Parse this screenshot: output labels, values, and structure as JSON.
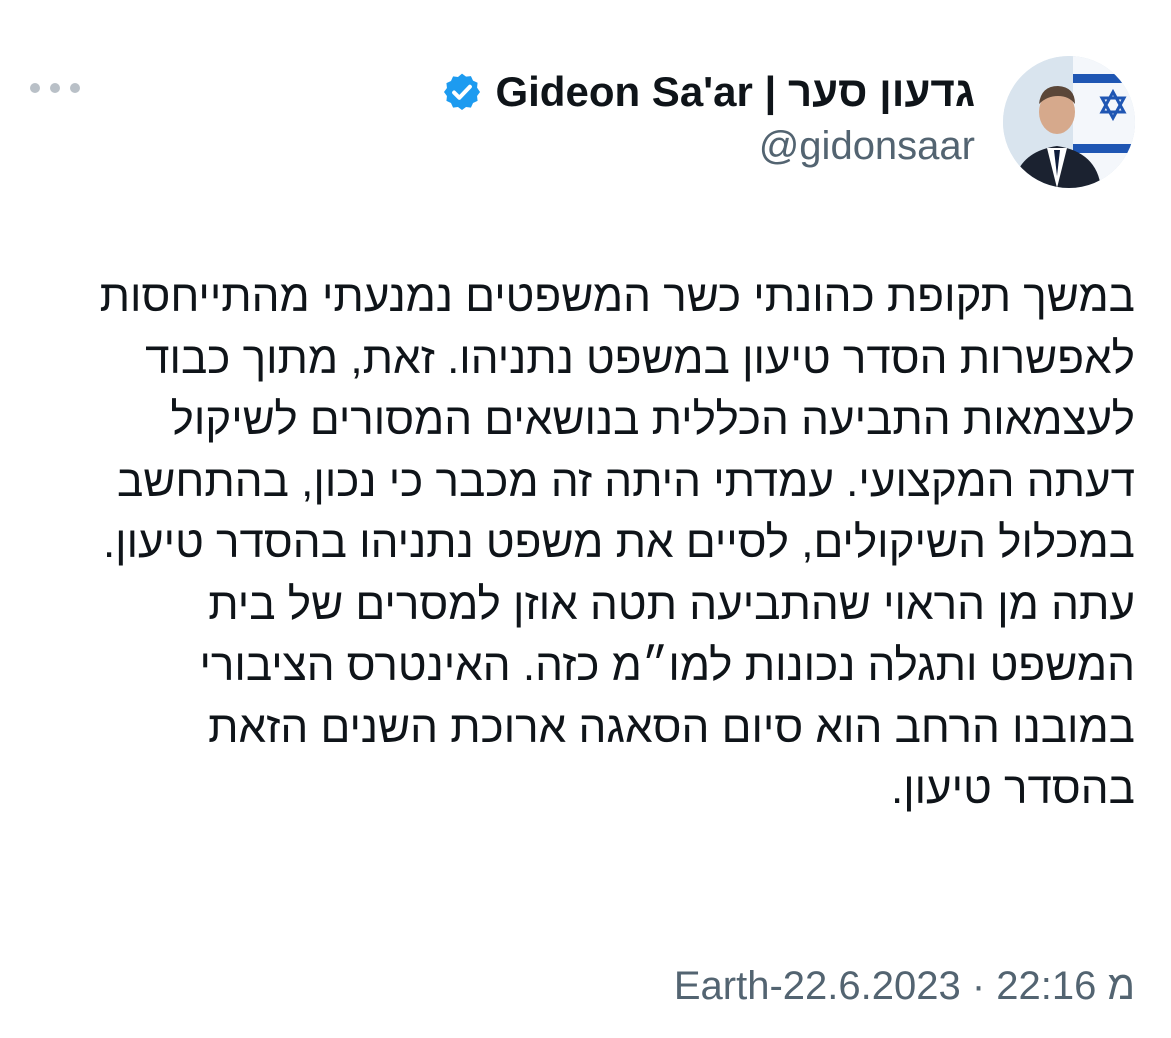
{
  "tweet": {
    "author": {
      "display_name": "גדעון סער | Gideon Sa'ar",
      "handle": "@gidonsaar",
      "verified": true,
      "verified_icon": "verified-badge-icon",
      "verified_color": "#1d9bf0"
    },
    "more_icon": "more-horizontal-icon",
    "text_lines": [
      "במשך תקופת כהונתי כשר המשפטים נמנעתי מהתייחסות",
      "לאפשרות הסדר טיעון במשפט נתניהו. זאת, מתוך כבוד",
      "לעצמאות התביעה הכללית בנושאים המסורים לשיקול",
      "דעתה המקצועי. עמדתי היתה זה מכבר כי נכון, בהתחשב",
      "במכלול השיקולים, לסיים את משפט נתניהו בהסדר טיעון.",
      "עתה מן הראוי שהתביעה תטה אוזן למסרים של בית",
      "המשפט ותגלה נכונות למו״מ כזה. האינטרס הציבורי",
      "במובנו הרחב הוא סיום הסאגה ארוכת השנים הזאת",
      "בהסדר טיעון."
    ],
    "meta": "Earth-מ 22:16 · 22.6.2023"
  },
  "colors": {
    "text": "#0f1419",
    "secondary": "#536471",
    "accent": "#1d9bf0"
  }
}
